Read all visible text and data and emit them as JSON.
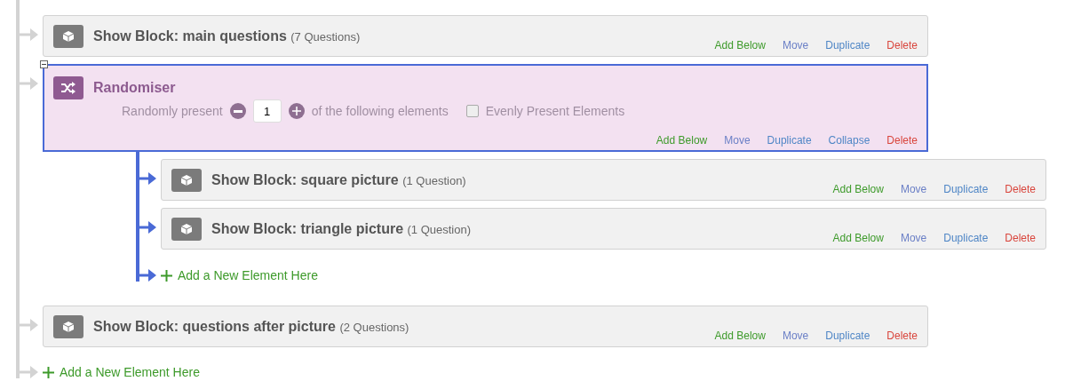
{
  "flow": [
    {
      "kind": "block",
      "title": "Show Block: main questions",
      "count": "(7 Questions)",
      "actions": [
        {
          "kind": "add",
          "label": "Add Below"
        },
        {
          "kind": "move",
          "label": "Move"
        },
        {
          "kind": "duplicate",
          "label": "Duplicate"
        },
        {
          "kind": "delete",
          "label": "Delete"
        }
      ]
    },
    {
      "kind": "randomiser",
      "title": "Randomiser",
      "expanded": true,
      "present_label": "Randomly present",
      "present_value": "1",
      "present_suffix": "of the following elements",
      "evenly": {
        "label": "Evenly Present Elements",
        "checked": false
      },
      "actions": [
        {
          "kind": "add",
          "label": "Add Below"
        },
        {
          "kind": "move",
          "label": "Move"
        },
        {
          "kind": "duplicate",
          "label": "Duplicate"
        },
        {
          "kind": "collapse",
          "label": "Collapse"
        },
        {
          "kind": "delete",
          "label": "Delete"
        }
      ],
      "children": [
        {
          "kind": "block",
          "title": "Show Block: square picture",
          "count": "(1 Question)",
          "actions": [
            {
              "kind": "add",
              "label": "Add Below"
            },
            {
              "kind": "move",
              "label": "Move"
            },
            {
              "kind": "duplicate",
              "label": "Duplicate"
            },
            {
              "kind": "delete",
              "label": "Delete"
            }
          ]
        },
        {
          "kind": "block",
          "title": "Show Block: triangle picture",
          "count": "(1 Question)",
          "actions": [
            {
              "kind": "add",
              "label": "Add Below"
            },
            {
              "kind": "move",
              "label": "Move"
            },
            {
              "kind": "duplicate",
              "label": "Duplicate"
            },
            {
              "kind": "delete",
              "label": "Delete"
            }
          ]
        }
      ],
      "add_element": "Add a New Element Here"
    },
    {
      "kind": "block",
      "title": "Show Block: questions after picture",
      "count": "(2 Questions)",
      "actions": [
        {
          "kind": "add",
          "label": "Add Below"
        },
        {
          "kind": "move",
          "label": "Move"
        },
        {
          "kind": "duplicate",
          "label": "Duplicate"
        },
        {
          "kind": "delete",
          "label": "Delete"
        }
      ]
    }
  ],
  "add_element": "Add a New Element Here"
}
